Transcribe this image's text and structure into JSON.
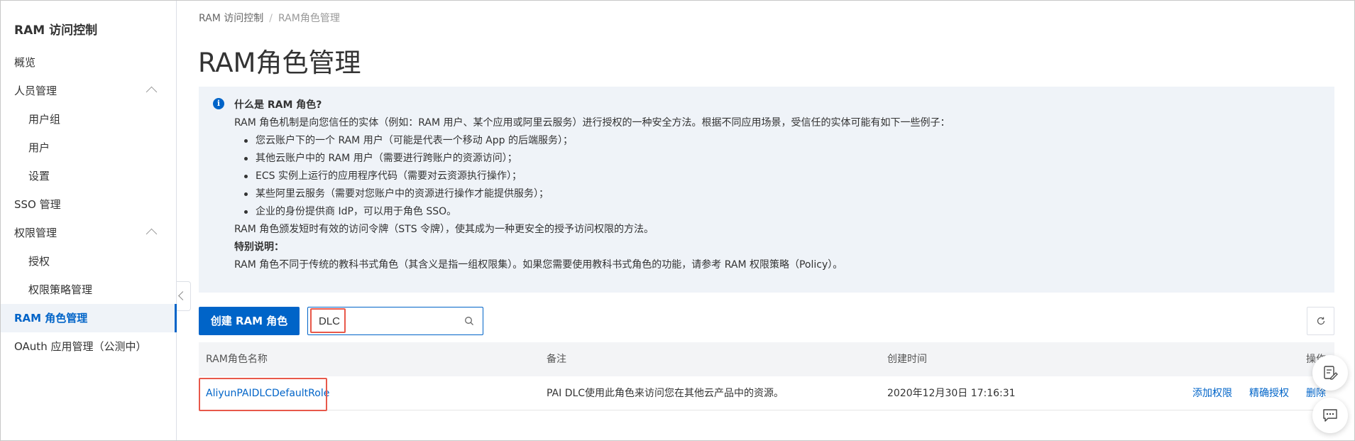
{
  "sidebar": {
    "title": "RAM 访问控制",
    "items": [
      {
        "label": "概览"
      },
      {
        "label": "人员管理"
      },
      {
        "label": "用户组"
      },
      {
        "label": "用户"
      },
      {
        "label": "设置"
      },
      {
        "label": "SSO 管理"
      },
      {
        "label": "权限管理"
      },
      {
        "label": "授权"
      },
      {
        "label": "权限策略管理"
      },
      {
        "label": "RAM 角色管理"
      },
      {
        "label": "OAuth 应用管理（公测中）"
      }
    ]
  },
  "breadcrumb": {
    "root": "RAM 访问控制",
    "sep": "/",
    "current": "RAM角色管理"
  },
  "page_title": "RAM角色管理",
  "info": {
    "heading": "什么是 RAM 角色?",
    "intro": "RAM 角色机制是向您信任的实体（例如：RAM 用户、某个应用或阿里云服务）进行授权的一种安全方法。根据不同应用场景，受信任的实体可能有如下一些例子：",
    "bullets": [
      "您云账户下的一个 RAM 用户（可能是代表一个移动 App 的后端服务）；",
      "其他云账户中的 RAM 用户（需要进行跨账户的资源访问）；",
      "ECS 实例上运行的应用程序代码（需要对云资源执行操作）；",
      "某些阿里云服务（需要对您账户中的资源进行操作才能提供服务）；",
      "企业的身份提供商 IdP，可以用于角色 SSO。"
    ],
    "sts_note": "RAM 角色颁发短时有效的访问令牌（STS 令牌），使其成为一种更安全的授予访问权限的方法。",
    "special_heading": "特别说明：",
    "special_text": "RAM 角色不同于传统的教科书式角色（其含义是指一组权限集）。如果您需要使用教科书式角色的功能，请参考 RAM 权限策略（Policy）。"
  },
  "toolbar": {
    "create_label": "创建 RAM 角色",
    "search_value": "DLC"
  },
  "table": {
    "headers": [
      "RAM角色名称",
      "备注",
      "创建时间",
      "操作"
    ],
    "rows": [
      {
        "name": "AliyunPAIDLCDefaultRole",
        "remark": "PAI DLC使用此角色来访问您在其他云产品中的资源。",
        "created": "2020年12月30日 17:16:31",
        "actions": [
          "添加权限",
          "精确授权",
          "删除"
        ]
      }
    ]
  },
  "colors": {
    "accent": "#0064c8",
    "highlight": "#e8584a",
    "info_bg": "#eff3f8"
  }
}
